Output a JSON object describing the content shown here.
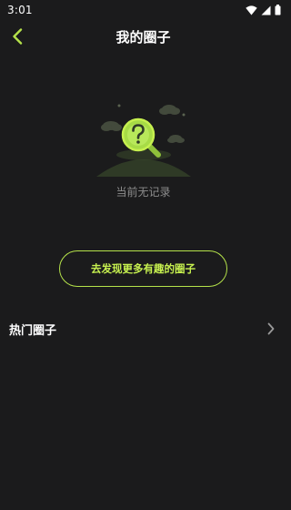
{
  "status_bar": {
    "time": "3:01",
    "icons": [
      "wifi-icon",
      "signal-icon",
      "battery-icon"
    ]
  },
  "header": {
    "back_icon": "chevron-left-icon",
    "title": "我的圈子"
  },
  "empty_state": {
    "illustration": "magnifier-question-icon",
    "text": "当前无记录"
  },
  "discover_button": {
    "label": "去发现更多有趣的圈子"
  },
  "hot_section": {
    "label": "热门圈子",
    "chevron_icon": "chevron-right-icon"
  },
  "colors": {
    "background": "#1b1b1c",
    "accent": "#b5e24a",
    "accent_text": "#c6f04f",
    "muted_text": "#8c8c8c"
  }
}
